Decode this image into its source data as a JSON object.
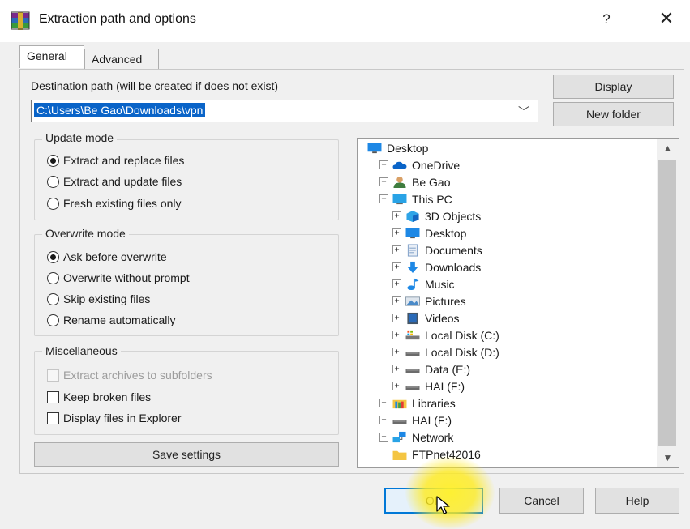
{
  "window": {
    "title": "Extraction path and options",
    "help_glyph": "?",
    "close_glyph": "✕"
  },
  "tabs": [
    {
      "label": "General",
      "active": true
    },
    {
      "label": "Advanced",
      "active": false
    }
  ],
  "destination": {
    "label": "Destination path (will be created if does not exist)",
    "value": "C:\\Users\\Be Gao\\Downloads\\vpn",
    "chevron": "﹀"
  },
  "buttons": {
    "display": "Display",
    "new_folder": "New folder",
    "save_settings": "Save settings",
    "ok": "OK",
    "cancel": "Cancel",
    "help": "Help"
  },
  "update_mode": {
    "title": "Update mode",
    "options": [
      {
        "label": "Extract and replace files",
        "selected": true
      },
      {
        "label": "Extract and update files",
        "selected": false
      },
      {
        "label": "Fresh existing files only",
        "selected": false
      }
    ]
  },
  "overwrite_mode": {
    "title": "Overwrite mode",
    "options": [
      {
        "label": "Ask before overwrite",
        "selected": true
      },
      {
        "label": "Overwrite without prompt",
        "selected": false
      },
      {
        "label": "Skip existing files",
        "selected": false
      },
      {
        "label": "Rename automatically",
        "selected": false
      }
    ]
  },
  "misc": {
    "title": "Miscellaneous",
    "options": [
      {
        "label": "Extract archives to subfolders",
        "checked": false,
        "disabled": true
      },
      {
        "label": "Keep broken files",
        "checked": false,
        "disabled": false
      },
      {
        "label": "Display files in Explorer",
        "checked": false,
        "disabled": false
      }
    ]
  },
  "tree": {
    "items": [
      {
        "label": "Desktop",
        "level": 0,
        "expander": "",
        "icon": "desktop-icon"
      },
      {
        "label": "OneDrive",
        "level": 1,
        "expander": "+",
        "icon": "onedrive-icon"
      },
      {
        "label": "Be Gao",
        "level": 1,
        "expander": "+",
        "icon": "user-icon"
      },
      {
        "label": "This PC",
        "level": 1,
        "expander": "−",
        "icon": "this-pc-icon"
      },
      {
        "label": "3D Objects",
        "level": 2,
        "expander": "+",
        "icon": "3d-objects-icon"
      },
      {
        "label": "Desktop",
        "level": 2,
        "expander": "+",
        "icon": "desktop-icon"
      },
      {
        "label": "Documents",
        "level": 2,
        "expander": "+",
        "icon": "documents-icon"
      },
      {
        "label": "Downloads",
        "level": 2,
        "expander": "+",
        "icon": "downloads-icon"
      },
      {
        "label": "Music",
        "level": 2,
        "expander": "+",
        "icon": "music-icon"
      },
      {
        "label": "Pictures",
        "level": 2,
        "expander": "+",
        "icon": "pictures-icon"
      },
      {
        "label": "Videos",
        "level": 2,
        "expander": "+",
        "icon": "videos-icon"
      },
      {
        "label": "Local Disk (C:)",
        "level": 2,
        "expander": "+",
        "icon": "system-drive-icon"
      },
      {
        "label": "Local Disk (D:)",
        "level": 2,
        "expander": "+",
        "icon": "drive-icon"
      },
      {
        "label": "Data (E:)",
        "level": 2,
        "expander": "+",
        "icon": "drive-icon"
      },
      {
        "label": "HAI (F:)",
        "level": 2,
        "expander": "+",
        "icon": "drive-icon"
      },
      {
        "label": "Libraries",
        "level": 1,
        "expander": "+",
        "icon": "libraries-icon"
      },
      {
        "label": "HAI (F:)",
        "level": 1,
        "expander": "+",
        "icon": "drive-icon"
      },
      {
        "label": "Network",
        "level": 1,
        "expander": "+",
        "icon": "network-icon"
      },
      {
        "label": "FTPnet42016",
        "level": 1,
        "expander": "",
        "icon": "folder-icon"
      }
    ]
  },
  "colors": {
    "accent": "#0078d7",
    "selection": "#0a64c8",
    "cursor_highlight": "#ffeb1e"
  }
}
